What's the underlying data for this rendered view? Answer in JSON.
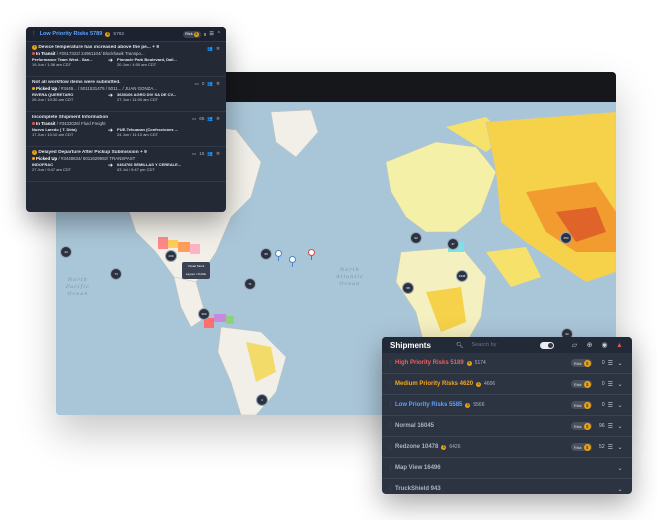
{
  "colors": {
    "high": "#ef5f5f",
    "medium": "#f5a623",
    "low": "#5da0ff",
    "neutral": "#aab3c2",
    "panel": "#2c3442",
    "coin": "#e8a417"
  },
  "map": {
    "ocean_labels": {
      "north_pacific": "North\nPacific\nOcean",
      "north_atlantic": "North\nAtlantic\nOcean"
    },
    "clusters": [
      "44",
      "74",
      "239",
      "99",
      "71",
      "300",
      "92",
      "47",
      "1948",
      "68",
      "250",
      "4",
      "62",
      "10",
      "8"
    ],
    "tooltip": "Visual Stock\n\nLayout • Profile"
  },
  "alert_panel": {
    "title": "Low Priority Risks 5789",
    "count": "5762",
    "pill_label": "Risk",
    "pill_icon": "coin-icon",
    "items": [
      {
        "title": "Device temperature has increased above the pe... + 9",
        "status_label": "In Transit",
        "status_detail": "/ #2517322/ 24961104/ Blockhawk Transpo...",
        "from_name": "Performance Team West - San...",
        "from_time": "19 Jun / 1:36 am CDT",
        "to_name": "Pinnacle Park Boulevard, Dall...",
        "to_time": "20 Jun / 4:00 am CDT",
        "comments": ""
      },
      {
        "title": "Not all workflow items were submitted.",
        "status_label": "Picked Up",
        "status_detail": "/ #3449... / 5011531475 / 5011... / JUAN GONZA...",
        "from_name": "RIVERA QUERETARO",
        "from_time": "26 Jun / 10:30 am CDT",
        "to_name": "3630106 AGRO DIV SA DE CV...",
        "to_time": "27 Jun / 11:00 am CDT",
        "comments": "0"
      },
      {
        "title": "Incomplete Shipment Information",
        "status_label": "In Transit",
        "status_detail": "/ #3432026/ Fluid Freight",
        "from_name": "Nuevo Laredo ( T. Diria)",
        "from_time": "17 Jun / 10:10 am CDT",
        "to_name": "PUE-Tehuacan (Confecciones ...",
        "to_time": "24 Jun / 11:10 am CDT",
        "comments": "65"
      },
      {
        "title": "Delayed Departure After Pickup Submission + 9",
        "status_label": "Picked Up",
        "status_detail": "/ #3448634/ 5011629992/ TRANSPAST",
        "from_name": "INDOFRAC",
        "from_time": "27 Jun / 9:47 am CDT",
        "to_name": "6464766 SEMILLAS Y CEREALE...",
        "to_time": "03 Jul / 9:47 pm CDT",
        "comments": "15"
      }
    ]
  },
  "shipments": {
    "title": "Shipments",
    "search_placeholder": "Search by",
    "rows": [
      {
        "name": "High Priority Risks 5189",
        "count": "5174",
        "pill": "Risk",
        "num": "0",
        "tone": "high",
        "has_pill": true
      },
      {
        "name": "Medium Priority Risks 4620",
        "count": "4606",
        "pill": "Risk",
        "num": "0",
        "tone": "medium",
        "has_pill": true
      },
      {
        "name": "Low Priority Risks 5585",
        "count": "5566",
        "pill": "Risk",
        "num": "0",
        "tone": "low",
        "has_pill": true
      },
      {
        "name": "Normal 16045",
        "count": "",
        "pill": "Risk",
        "num": "96",
        "tone": "neutral",
        "has_pill": true
      },
      {
        "name": "Redzone 10478",
        "count": "6426",
        "pill": "Risk",
        "num": "52",
        "tone": "neutral",
        "has_pill": true
      },
      {
        "name": "Map View 16496",
        "count": "",
        "pill": "",
        "num": "",
        "tone": "neutral",
        "has_pill": false
      },
      {
        "name": "TruckShield 943",
        "count": "",
        "pill": "",
        "num": "",
        "tone": "neutral",
        "has_pill": false
      }
    ]
  }
}
